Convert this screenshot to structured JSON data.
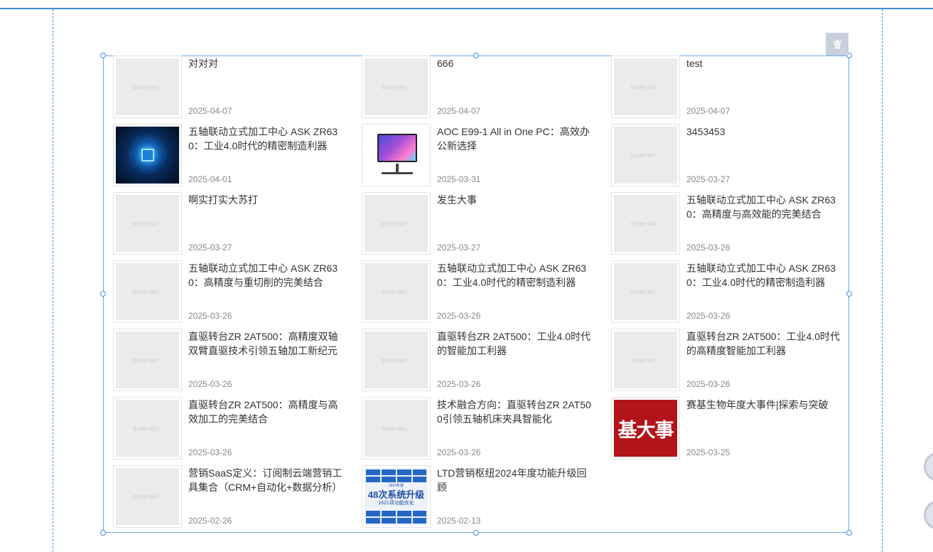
{
  "toolbar": {
    "delete_icon": "trash-icon"
  },
  "placeholder_text": "暂无图片展示一",
  "articles": [
    {
      "title": "对对对",
      "date": "2025-04-07",
      "image": "placeholder"
    },
    {
      "title": "666",
      "date": "2025-04-07",
      "image": "placeholder"
    },
    {
      "title": "test",
      "date": "2025-04-07",
      "image": "placeholder"
    },
    {
      "title": "五轴联动立式加工中心 ASK ZR630：工业4.0时代的精密制造利器",
      "date": "2025-04-01",
      "image": "blue-chip"
    },
    {
      "title": "AOC E99-1 All in One PC：高效办公新选择",
      "date": "2025-03-31",
      "image": "monitor"
    },
    {
      "title": "3453453",
      "date": "2025-03-27",
      "image": "placeholder"
    },
    {
      "title": "啊实打实大苏打",
      "date": "2025-03-27",
      "image": "placeholder"
    },
    {
      "title": "发生大事",
      "date": "2025-03-27",
      "image": "placeholder"
    },
    {
      "title": "五轴联动立式加工中心 ASK ZR630：高精度与高效能的完美结合",
      "date": "2025-03-26",
      "image": "placeholder"
    },
    {
      "title": "五轴联动立式加工中心 ASK ZR630：高精度与重切削的完美结合",
      "date": "2025-03-26",
      "image": "placeholder"
    },
    {
      "title": "五轴联动立式加工中心 ASK ZR630：工业4.0时代的精密制造利器",
      "date": "2025-03-26",
      "image": "placeholder"
    },
    {
      "title": "五轴联动立式加工中心 ASK ZR630：工业4.0时代的精密制造利器",
      "date": "2025-03-26",
      "image": "placeholder"
    },
    {
      "title": "直驱转台ZR 2AT500：高精度双轴双臂直驱技术引领五轴加工新纪元",
      "date": "2025-03-26",
      "image": "placeholder"
    },
    {
      "title": "直驱转台ZR 2AT500：工业4.0时代的智能加工利器",
      "date": "2025-03-26",
      "image": "placeholder"
    },
    {
      "title": "直驱转台ZR 2AT500：工业4.0时代的高精度智能加工利器",
      "date": "2025-03-26",
      "image": "placeholder"
    },
    {
      "title": "直驱转台ZR 2AT500：高精度与高效加工的完美结合",
      "date": "2025-03-26",
      "image": "placeholder"
    },
    {
      "title": "技术融合方向：直驱转台ZR 2AT500引领五轴机床夹具智能化",
      "date": "2025-03-26",
      "image": "placeholder"
    },
    {
      "title": "赛基生物年度大事件|探索与突破",
      "date": "2025-03-25",
      "image": "red-poster",
      "image_text": "基大事"
    },
    {
      "title": "营销SaaS定义：订阅制云端营销工具集合（CRM+自动化+数据分析）",
      "date": "2025-02-26",
      "image": "placeholder"
    },
    {
      "title": "LTD营销枢纽2024年度功能升级回顾",
      "date": "2025-02-13",
      "image": "blue-poster",
      "image_text": {
        "top": "2024年度",
        "big": "48次系统升级",
        "small": "1621项功能优化"
      }
    }
  ]
}
